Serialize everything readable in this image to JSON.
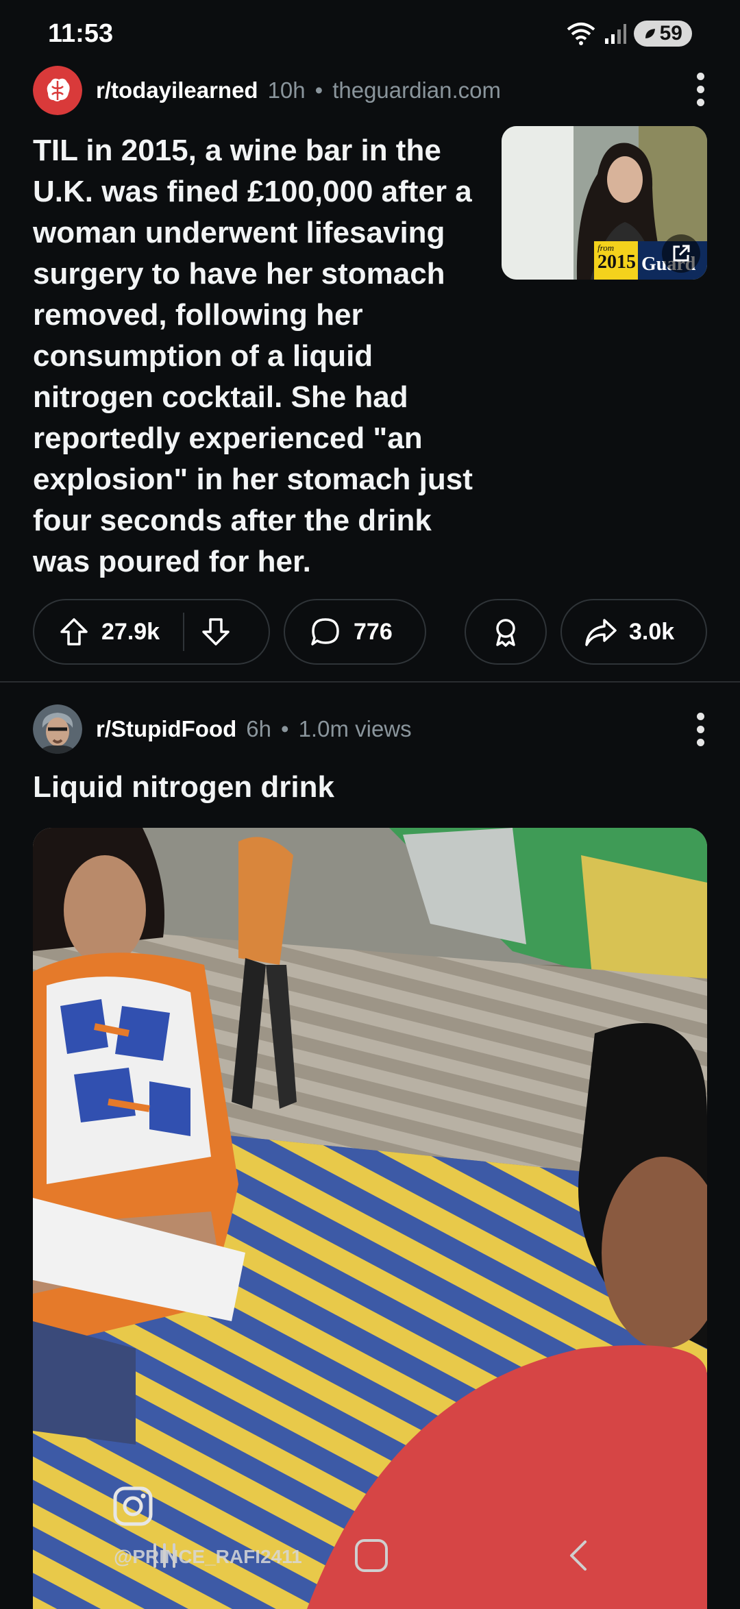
{
  "status_bar": {
    "time": "11:53",
    "battery": "59",
    "icons": [
      "wifi-icon",
      "signal-icon",
      "battery-icon"
    ]
  },
  "post1": {
    "subreddit": "r/todayilearned",
    "age": "10h",
    "domain": "theguardian.com",
    "title": "TIL in 2015, a wine bar in the U.K. was fined £100,000 after a woman underwent lifesaving surgery to have her stomach removed, following her consumption of a liquid nitrogen cocktail. She had reportedly experienced \"an explosion\" in her stomach just four seconds after the drink was poured for her.",
    "thumbnail": {
      "badge_from": "from",
      "badge_year": "2015",
      "masthead": "Guard"
    },
    "upvotes": "27.9k",
    "comments": "776",
    "shares": "3.0k"
  },
  "post2": {
    "subreddit": "r/StupidFood",
    "age": "6h",
    "views": "1.0m views",
    "title": "Liquid nitrogen drink",
    "watermark": "@PRINCE_RAFI2411"
  },
  "colors": {
    "background": "#0b0d0f",
    "border": "#2f3438",
    "muted_text": "#8a959c",
    "subreddit_icon_red": "#d93a3a"
  }
}
